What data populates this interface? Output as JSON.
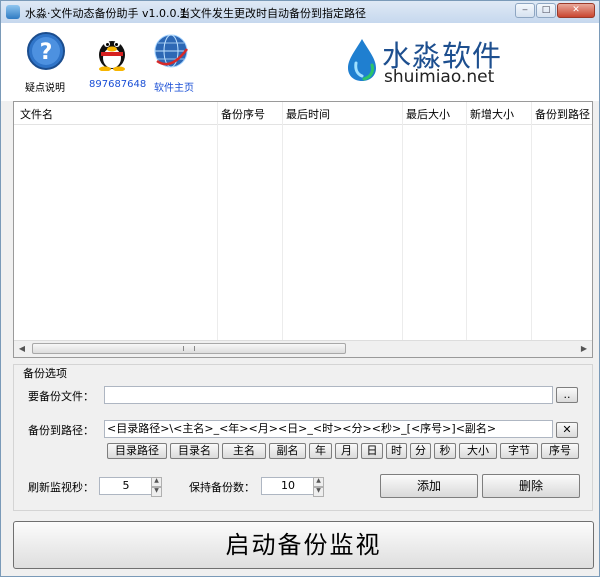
{
  "window": {
    "title": "水淼·文件动态备份助手 v1.0.0.1",
    "note": "当文件发生更改时自动备份到指定路径"
  },
  "header": {
    "items": [
      {
        "label": "疑点说明",
        "icon": "help-icon"
      },
      {
        "label": "897687648",
        "icon": "qq-penguin-icon",
        "color": "#1a4fd6"
      },
      {
        "label": "软件主页",
        "icon": "globe-icon",
        "color": "#1a4fd6"
      }
    ],
    "logo": {
      "cn": "水淼软件",
      "en": "shuimiao.net"
    }
  },
  "table": {
    "columns": [
      "文件名",
      "备份序号",
      "最后时间",
      "最后大小",
      "新增大小",
      "备份到路径"
    ],
    "rows": []
  },
  "options": {
    "group_title": "备份选项",
    "file_label": "要备份文件：",
    "file_value": "",
    "browse_label": "..",
    "path_label": "备份到路径：",
    "path_value": "<目录路径>\\<主名>_<年><月><日>_<时><分><秒>_[<序号>]<副名>",
    "clear_label": "✕",
    "tokens": [
      "目录路径",
      "目录名",
      "主名",
      "副名",
      "年",
      "月",
      "日",
      "时",
      "分",
      "秒",
      "大小",
      "字节",
      "序号"
    ],
    "refresh_label": "刷新监视秒：",
    "refresh_value": "5",
    "keep_label": "保持备份数：",
    "keep_value": "10",
    "add_label": "添加",
    "delete_label": "删除"
  },
  "start_label": "启动备份监视",
  "colors": {
    "link": "#1a4fd6",
    "logo": "#1d4f8f"
  }
}
